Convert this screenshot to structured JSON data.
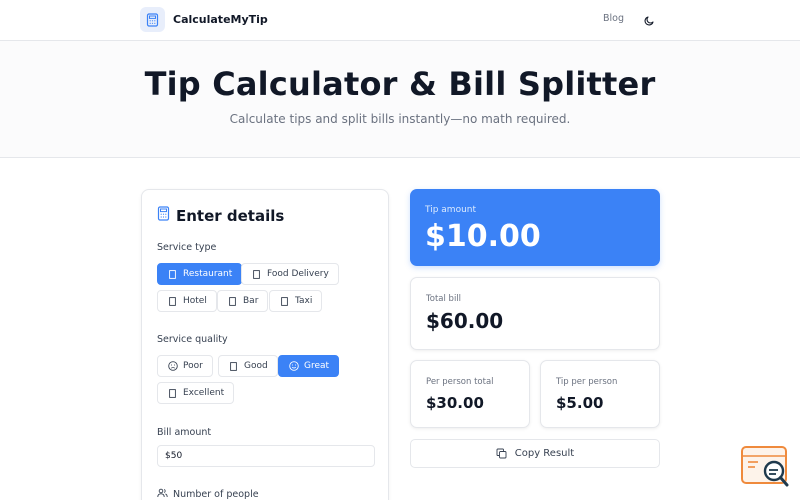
{
  "nav": {
    "brand": "CalculateMyTip",
    "blog": "Blog"
  },
  "hero": {
    "title": "Tip Calculator & Bill Splitter",
    "subtitle": "Calculate tips and split bills instantly—no math required."
  },
  "form": {
    "title": "Enter details",
    "service_type_label": "Service type",
    "service_types": [
      {
        "label": "Restaurant",
        "selected": true
      },
      {
        "label": "Food Delivery",
        "selected": false
      },
      {
        "label": "Hotel",
        "selected": false
      },
      {
        "label": "Bar",
        "selected": false
      },
      {
        "label": "Taxi",
        "selected": false
      }
    ],
    "service_quality_label": "Service quality",
    "service_quality": [
      {
        "label": "Poor",
        "icon": "frown-icon",
        "selected": false
      },
      {
        "label": "Good",
        "icon": "box-icon",
        "selected": false
      },
      {
        "label": "Great",
        "icon": "smile-icon",
        "selected": true
      },
      {
        "label": "Excellent",
        "icon": "box-icon",
        "selected": false
      }
    ],
    "bill_amount_label": "Bill amount",
    "bill_amount_value": "$50",
    "people_label": "Number of people"
  },
  "results": {
    "tip_label": "Tip amount",
    "tip_value": "$10.00",
    "total_label": "Total bill",
    "total_value": "$60.00",
    "per_person_total_label": "Per person total",
    "per_person_total_value": "$30.00",
    "tip_per_person_label": "Tip per person",
    "tip_per_person_value": "$5.00",
    "copy_label": "Copy Result"
  },
  "colors": {
    "accent": "#3b82f6",
    "text": "#111827",
    "muted": "#6b7280",
    "border": "#e5e7eb"
  }
}
